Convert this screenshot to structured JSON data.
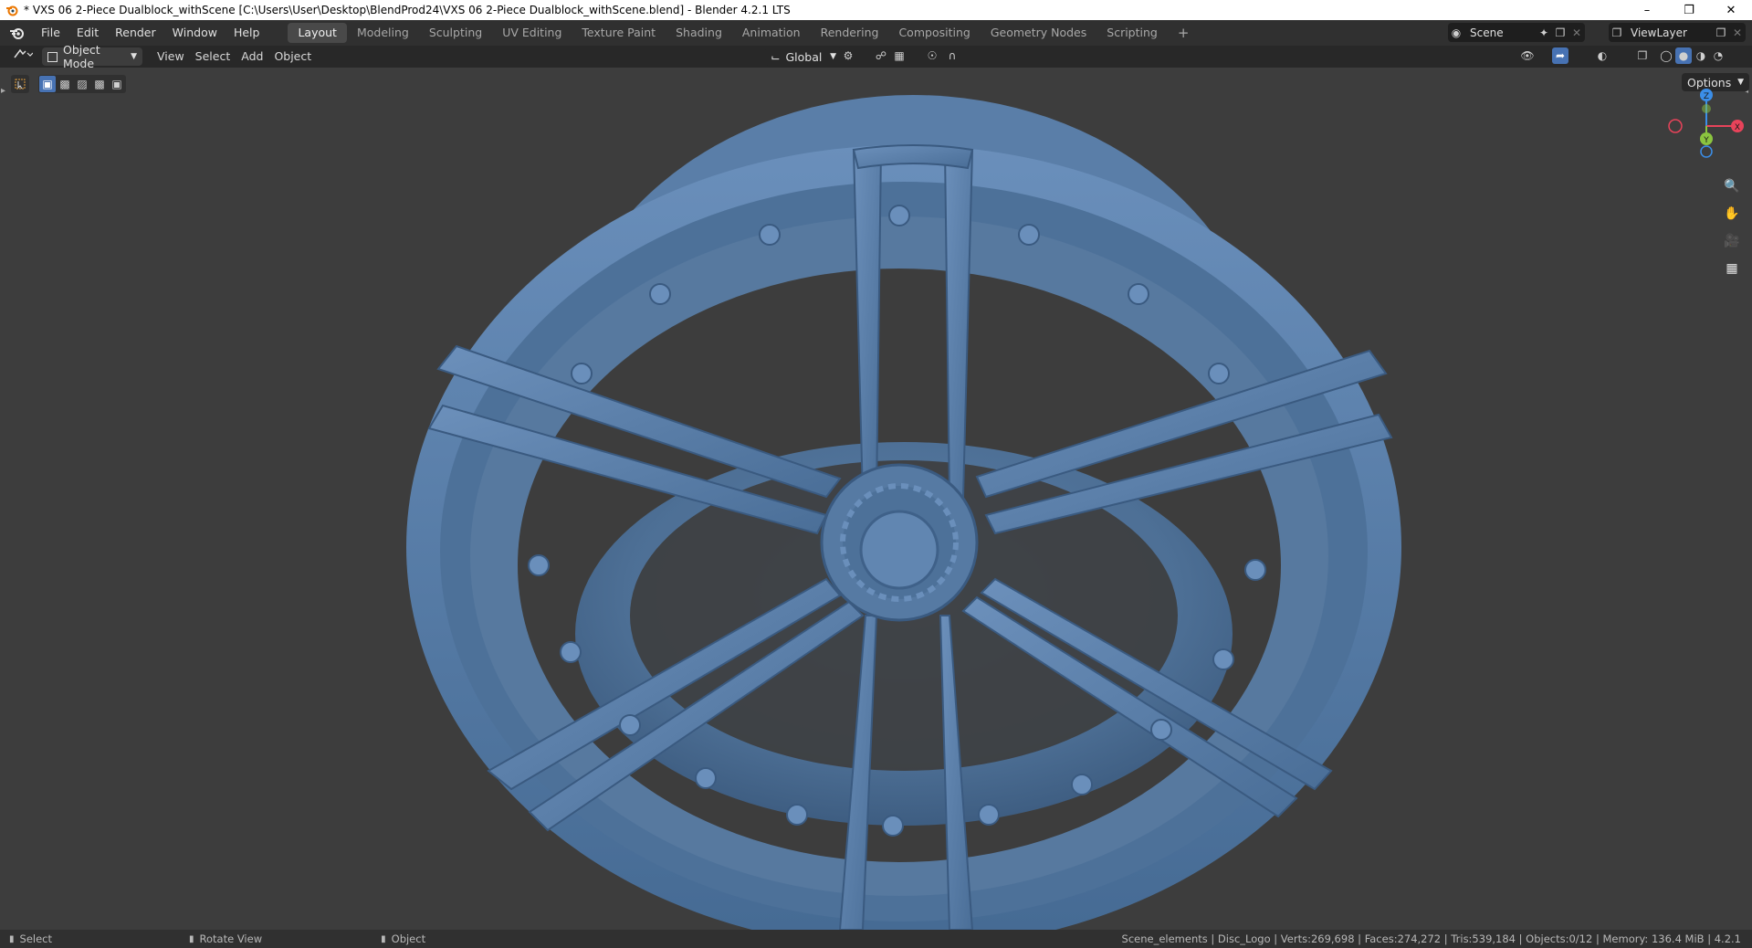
{
  "window": {
    "title": "* VXS 06 2-Piece Dualblock_withScene [C:\\Users\\User\\Desktop\\BlendProd24\\VXS 06 2-Piece Dualblock_withScene.blend] - Blender 4.2.1 LTS",
    "minimize": "–",
    "maximize": "❐",
    "close": "✕"
  },
  "menu": [
    "File",
    "Edit",
    "Render",
    "Window",
    "Help"
  ],
  "workspaces": [
    "Layout",
    "Modeling",
    "Sculpting",
    "UV Editing",
    "Texture Paint",
    "Shading",
    "Animation",
    "Rendering",
    "Compositing",
    "Geometry Nodes",
    "Scripting"
  ],
  "workspace_add": "+",
  "scene": {
    "name": "Scene",
    "view_layer": "ViewLayer"
  },
  "header": {
    "mode": "Object Mode",
    "menus": [
      "View",
      "Select",
      "Add",
      "Object"
    ],
    "orientation": "Global",
    "options": "Options"
  },
  "gizmo": {
    "z": "Z",
    "y": "Y",
    "x": "X"
  },
  "status": {
    "left": [
      "Select",
      "Rotate View",
      "Object"
    ],
    "right": "Scene_elements | Disc_Logo | Verts:269,698 | Faces:274,272 | Tris:539,184 | Objects:0/12 | Memory: 136.4 MiB | 4.2.1"
  },
  "colors": {
    "wheel": "#52769f",
    "viewport": "#3d3d3d",
    "axis_x": "#e8435a",
    "axis_y": "#8bc53f",
    "axis_z": "#3b8ee8",
    "accent": "#4772b3"
  }
}
